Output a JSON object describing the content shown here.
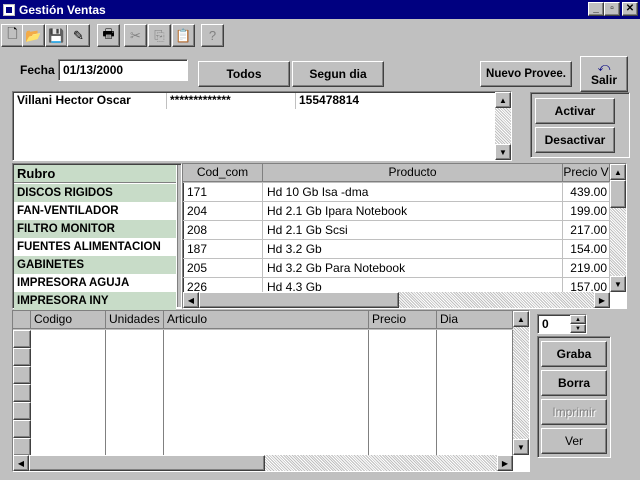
{
  "window": {
    "title": "Gestión Ventas",
    "minimize": "_",
    "restore": "▫",
    "close": "✕"
  },
  "toolbar": {
    "icons": [
      "new-icon",
      "open-icon",
      "save-icon",
      "edit-icon",
      "print-icon",
      "cut-icon",
      "copy-icon",
      "paste-icon",
      "help-icon"
    ],
    "glyphs": [
      "🗋",
      "📂",
      "💾",
      "✎",
      "🖶",
      "✂",
      "⎘",
      "📋",
      "?"
    ]
  },
  "header": {
    "fecha_label": "Fecha",
    "fecha_value": "01/13/2000",
    "todos_label": "Todos",
    "segun_dia_label": "Segun dia",
    "nuevo_proveedor_label": "Nuevo Provee.",
    "salir_label": "Salir"
  },
  "proveedor": {
    "name": "Villani Hector Oscar",
    "password": "*************",
    "phone": "155478814",
    "activar_label": "Activar",
    "desactivar_label": "Desactivar"
  },
  "rubros": {
    "header": "Rubro",
    "items": [
      "DISCOS RIGIDOS",
      "FAN-VENTILADOR",
      "FILTRO MONITOR",
      "FUENTES ALIMENTACION",
      "GABINETES",
      "IMPRESORA AGUJA",
      "IMPRESORA INY"
    ]
  },
  "productos": {
    "columns": [
      "Cod_com",
      "Producto",
      "Precio V"
    ],
    "rows": [
      [
        "171",
        "Hd 10 Gb  Isa -dma",
        "439.00"
      ],
      [
        "204",
        "Hd  2.1 Gb Ipara Notebook",
        "199.00"
      ],
      [
        "208",
        "Hd  2.1 Gb Scsi",
        "217.00"
      ],
      [
        "187",
        "Hd  3.2 Gb",
        "154.00"
      ],
      [
        "205",
        "Hd  3.2 Gb Para Notebook",
        "219.00"
      ],
      [
        "226",
        "Hd  4.3 Gb",
        "157.00"
      ]
    ]
  },
  "detalle": {
    "columns": [
      "Codigo",
      "Unidades",
      "Articulo",
      "Precio",
      "Dia"
    ]
  },
  "spinner": {
    "value": "0"
  },
  "actions": {
    "graba": "Graba",
    "borra": "Borra",
    "imprimir": "Imprimir",
    "ver": "Ver"
  },
  "colors": {
    "titlebar": "#000080",
    "rubro_highlight": "#c8dcc8",
    "face": "#c0c0c0"
  }
}
